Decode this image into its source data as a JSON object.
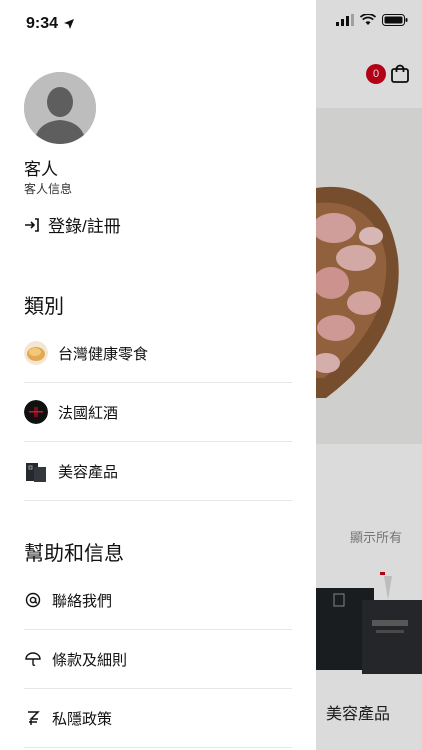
{
  "status": {
    "time": "9:34"
  },
  "drawer": {
    "guest": {
      "name": "客人",
      "info": "客人信息"
    },
    "login_label": "登錄/註冊",
    "categories_title": "類別",
    "categories": [
      {
        "label": "台灣健康零食",
        "icon": "snack-thumb-icon"
      },
      {
        "label": "法國紅酒",
        "icon": "wine-thumb-icon"
      },
      {
        "label": "美容產品",
        "icon": "beauty-thumb-icon"
      }
    ],
    "help_title": "幫助和信息",
    "help_items": [
      {
        "label": "聯絡我們",
        "icon": "at-icon"
      },
      {
        "label": "條款及細則",
        "icon": "umbrella-icon"
      },
      {
        "label": "私隱政策",
        "icon": "privacy-icon"
      }
    ]
  },
  "background": {
    "cart_count": "0",
    "show_all": "顯示所有",
    "product_label": "美容產品"
  },
  "colors": {
    "badge": "#d0021b",
    "divider": "#e6e6e6"
  }
}
